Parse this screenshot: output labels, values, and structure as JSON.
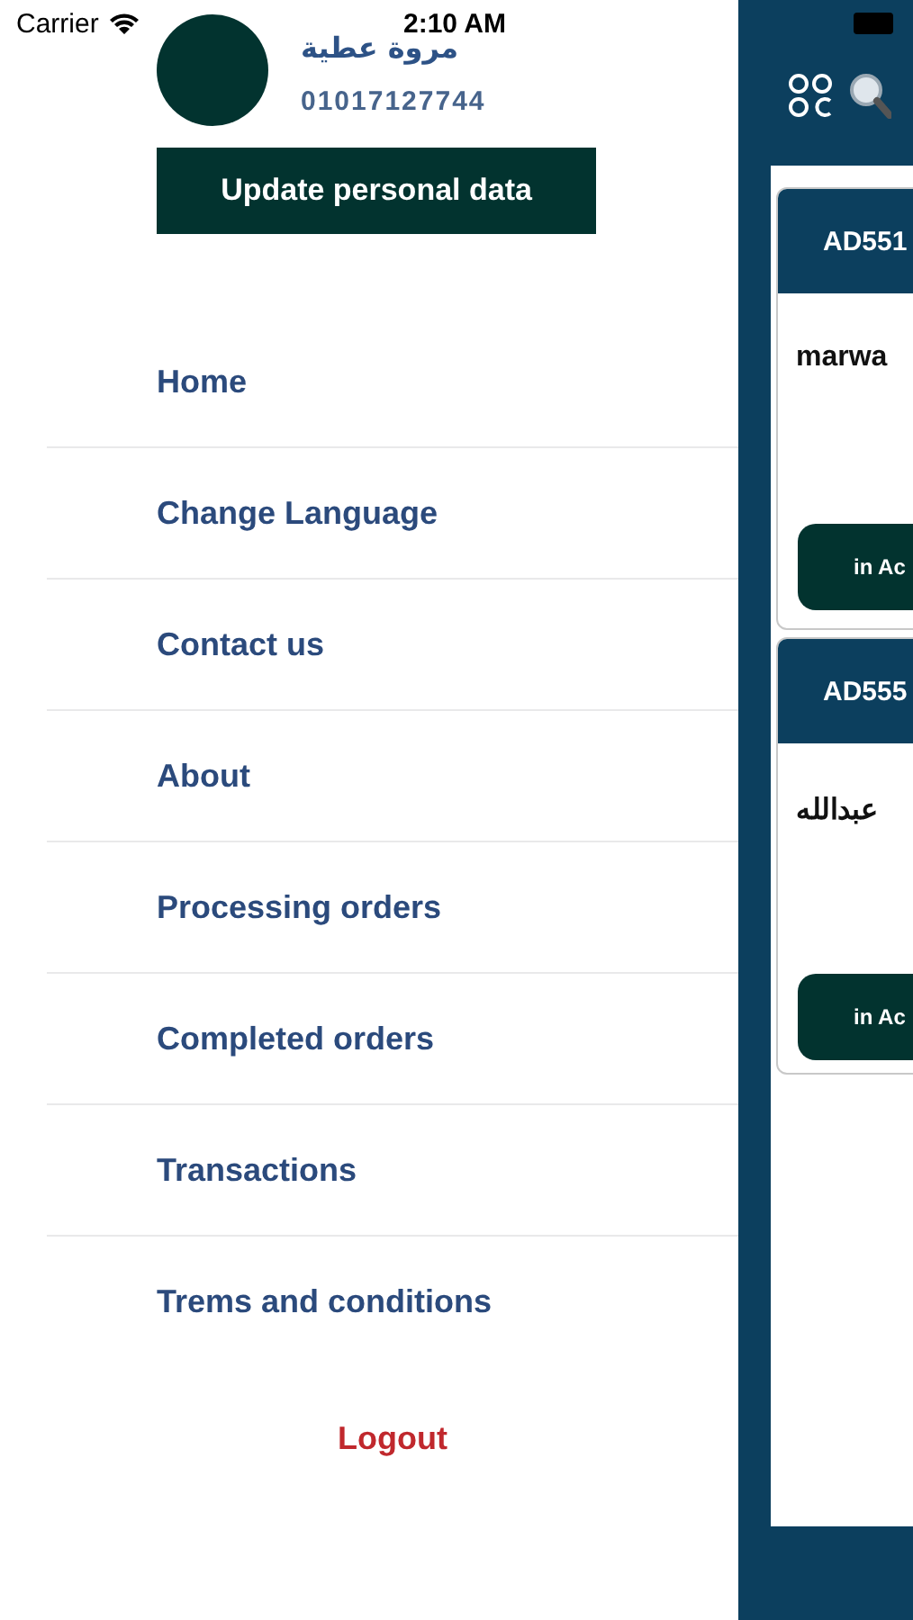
{
  "status_bar": {
    "carrier": "Carrier",
    "time": "2:10 AM"
  },
  "profile": {
    "name": "مروة عطية",
    "phone": "01017127744",
    "update_button": "Update personal data"
  },
  "menu": [
    {
      "label": "Home"
    },
    {
      "label": "Change Language"
    },
    {
      "label": "Contact us"
    },
    {
      "label": "About"
    },
    {
      "label": "Processing orders"
    },
    {
      "label": "Completed orders"
    },
    {
      "label": "Transactions"
    },
    {
      "label": "Trems and conditions"
    }
  ],
  "logout": "Logout",
  "orders": [
    {
      "code": "AD551",
      "name": "marwa",
      "status": "in Ac"
    },
    {
      "code": "AD555",
      "name": "عبدالله",
      "status": "in Ac"
    }
  ]
}
